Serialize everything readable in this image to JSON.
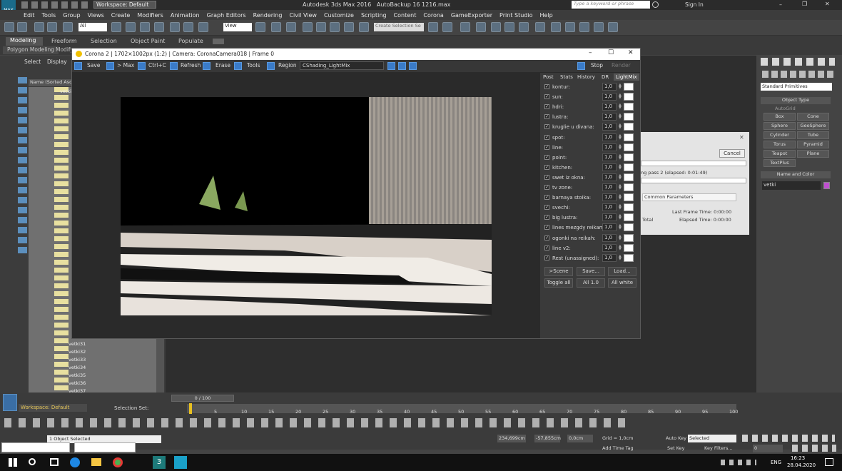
{
  "app": {
    "title": "Autodesk 3ds Max 2016",
    "file": "AutoBackup 16 1216.max",
    "workspace": "Workspace: Default",
    "search_placeholder": "Type a keyword or phrase",
    "sign_in": "Sign In"
  },
  "menu": [
    "Edit",
    "Tools",
    "Group",
    "Views",
    "Create",
    "Modifiers",
    "Animation",
    "Graph Editors",
    "Rendering",
    "Civil View",
    "Customize",
    "Scripting",
    "Content",
    "Corona",
    "GameExporter",
    "Print Studio",
    "Help"
  ],
  "toolbar": {
    "selection_filter": "All",
    "view": "View",
    "create_selection_set": "Create Selection Se"
  },
  "ribbon": {
    "tabs": [
      "Modeling",
      "Freeform",
      "Selection",
      "Object Paint",
      "Populate"
    ],
    "sub_tabs": [
      "Polygon Modeling",
      "Modify"
    ]
  },
  "scene_explorer": {
    "tabs": [
      "Select",
      "Display"
    ],
    "column": "Name (Sorted Ascen",
    "first_item": "vetki",
    "items": [
      "vetki31",
      "vetki32",
      "vetki33",
      "vetki34",
      "vetki35",
      "vetki36",
      "vetki37"
    ]
  },
  "vfb": {
    "title": "Corona 2 | 1702×1002px (1:2) | Camera: CoronaCamera018 | Frame 0",
    "tools": {
      "save": "Save",
      "max": "> Max",
      "ctrlc": "Ctrl+C",
      "refresh": "Refresh",
      "erase": "Erase",
      "tools": "Tools",
      "region": "Region",
      "channel": "CShading_LightMix",
      "stop": "Stop",
      "render": "Render"
    },
    "tabs": [
      "Post",
      "Stats",
      "History",
      "DR",
      "LightMix"
    ],
    "lights": [
      {
        "name": "kontur:",
        "value": "1,0"
      },
      {
        "name": "sun:",
        "value": "1,0"
      },
      {
        "name": "hdri:",
        "value": "1,0"
      },
      {
        "name": "lustra:",
        "value": "1,0"
      },
      {
        "name": "kruglie u divana:",
        "value": "1,0"
      },
      {
        "name": "spot:",
        "value": "1,0"
      },
      {
        "name": "line:",
        "value": "1,0"
      },
      {
        "name": "point:",
        "value": "1,0"
      },
      {
        "name": "kitchen:",
        "value": "1,0"
      },
      {
        "name": "swet iz okna:",
        "value": "1,0"
      },
      {
        "name": "tv zone:",
        "value": "1,0"
      },
      {
        "name": "barnaya stoika:",
        "value": "1,0"
      },
      {
        "name": "svechi:",
        "value": "1,0"
      },
      {
        "name": "big lustra:",
        "value": "1,0"
      },
      {
        "name": "lines mezgdy reikami:",
        "value": "1,0"
      },
      {
        "name": "ogonki na reikah:",
        "value": "1,0"
      },
      {
        "name": "line v2:",
        "value": "1,0"
      },
      {
        "name": "Rest (unassigned):",
        "value": "1,0"
      }
    ],
    "buttons": {
      "scene": ">Scene",
      "save": "Save...",
      "load": "Load...",
      "toggle": "Toggle all",
      "all10": "All 1.0",
      "allwhite": "All white"
    }
  },
  "render_dialog": {
    "cancel": "Cancel",
    "pass": "ng pass 2 (elapsed: 0:01:49)",
    "common": "Common Parameters",
    "last_frame": "Last Frame Time:  0:00:00",
    "total": "Total",
    "elapsed": "Elapsed Time:  0:00:00"
  },
  "command_panel": {
    "dropdown": "Standard Primitives",
    "object_type": "Object Type",
    "autogrid": "AutoGrid",
    "primitives": [
      "Box",
      "Cone",
      "Sphere",
      "GeoSphere",
      "Cylinder",
      "Tube",
      "Torus",
      "Pyramid",
      "Teapot",
      "Plane",
      "TextPlus"
    ],
    "name_color": "Name and Color",
    "name": "vetki",
    "name_color_swatch": "#c04fd0"
  },
  "timeline": {
    "frame": "0 / 100",
    "ticks": [
      "5",
      "10",
      "15",
      "20",
      "25",
      "30",
      "35",
      "40",
      "45",
      "50",
      "55",
      "60",
      "65",
      "70",
      "75",
      "80",
      "85",
      "90",
      "95",
      "100"
    ],
    "workspace": "Workspace: Default",
    "selection_set": "Selection Set:",
    "objects_selected": "1 Object Selected",
    "x": "234,699cm",
    "y": "-57,855cm",
    "z": "0,0cm",
    "grid": "Grid = 1,0cm",
    "add_time_tag": "Add Time Tag",
    "auto_key": "Auto Key",
    "set_key": "Set Key",
    "selected": "Selected",
    "key_filters": "Key Filters...",
    "frame_field": "0"
  },
  "taskbar": {
    "time": "16:23",
    "date": "28.04.2020",
    "lang": "ENG"
  }
}
